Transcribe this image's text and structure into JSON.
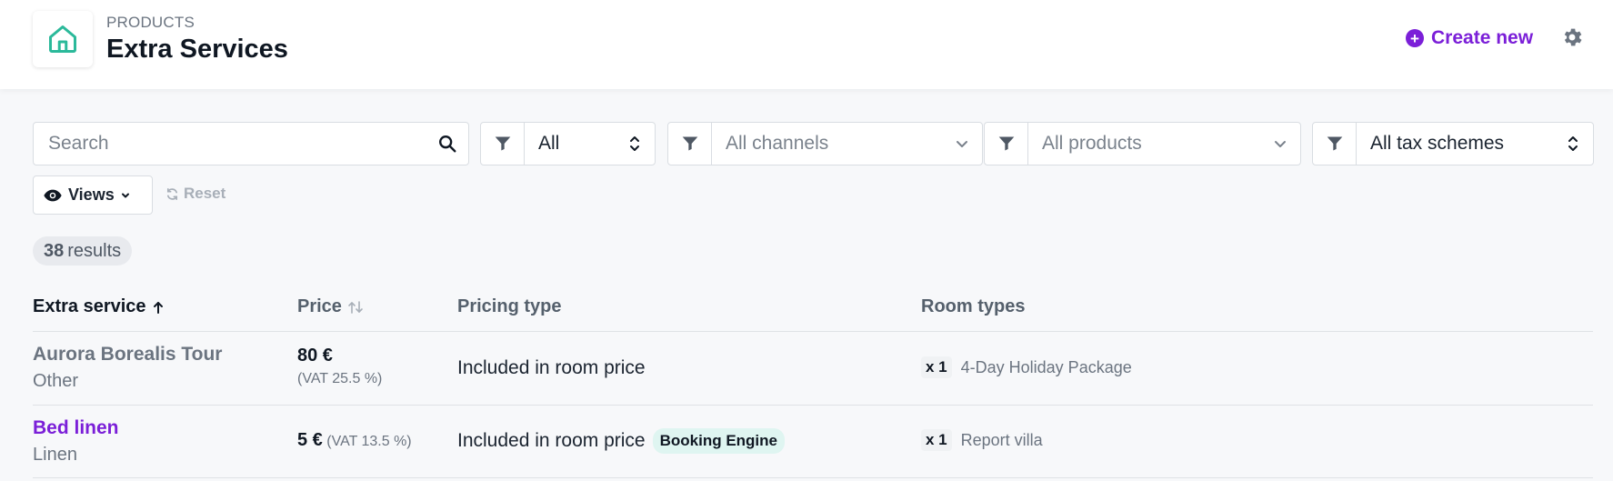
{
  "header": {
    "breadcrumb": "PRODUCTS",
    "title": "Extra Services",
    "create_label": "Create new",
    "icons": {
      "home": "home-icon",
      "create": "plus-circle-icon",
      "settings": "gear-icon"
    }
  },
  "filters": {
    "search_placeholder": "Search",
    "status_value": "All",
    "channels_placeholder": "All channels",
    "products_placeholder": "All products",
    "tax_value": "All tax schemes",
    "views_label": "Views",
    "reset_label": "Reset"
  },
  "results": {
    "count": "38",
    "label": "results"
  },
  "table": {
    "columns": {
      "service": "Extra service",
      "price": "Price",
      "pricing_type": "Pricing type",
      "room_types": "Room types"
    },
    "rows": [
      {
        "name": "Aurora Borealis Tour",
        "category": "Other",
        "price": "80 €",
        "vat": "(VAT 25.5 %)",
        "pricing_type": "Included in room price",
        "badge": "",
        "qty": "x 1",
        "room_type": "4-Day Holiday Package"
      },
      {
        "name": "Bed linen",
        "category": "Linen",
        "price": "5 €",
        "vat": "(VAT 13.5 %)",
        "pricing_type": "Included in room price",
        "badge": "Booking Engine",
        "qty": "x 1",
        "room_type": "Report villa"
      }
    ]
  },
  "colors": {
    "accent": "#7b1fd8",
    "home_icon": "#2bb99a",
    "badge_bg": "#dff5f1"
  }
}
